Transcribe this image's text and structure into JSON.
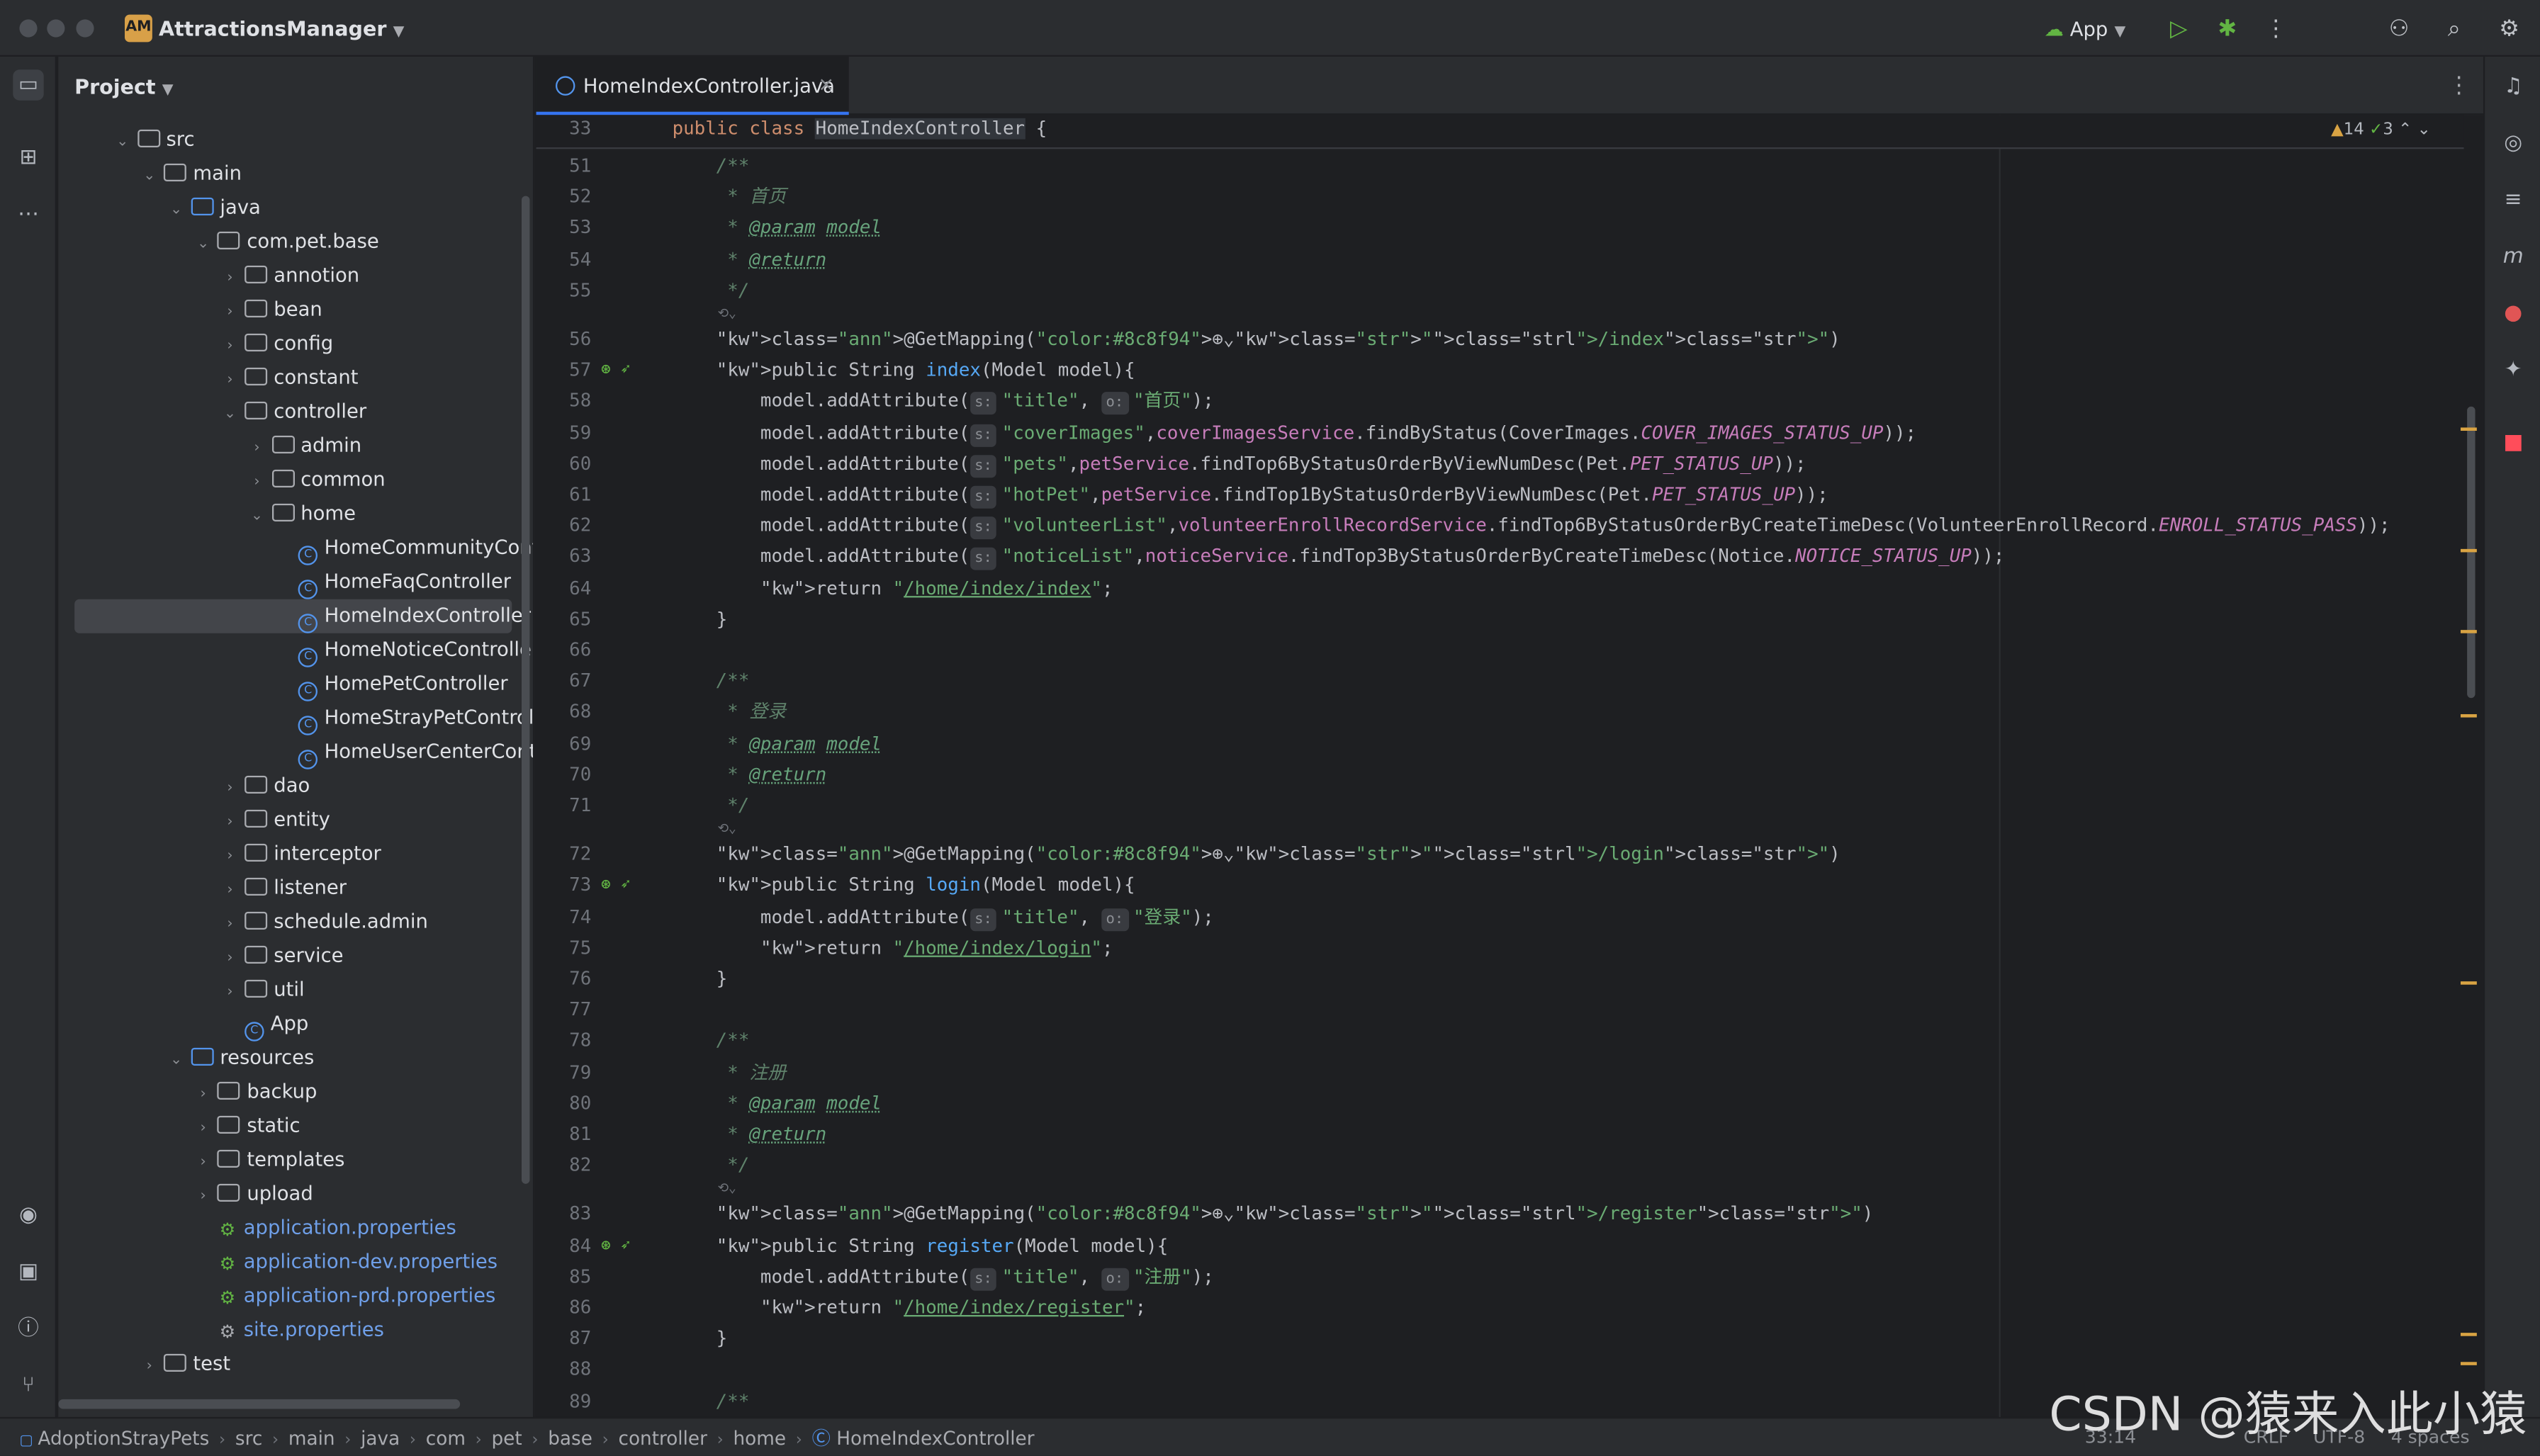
{
  "window": {
    "project_badge": "AM",
    "project_name": "AttractionsManager",
    "run_config": "App"
  },
  "project_panel": {
    "title": "Project",
    "tree": [
      {
        "label": "src",
        "depth": 2,
        "type": "folder",
        "expanded": true
      },
      {
        "label": "main",
        "depth": 3,
        "type": "folder",
        "expanded": true
      },
      {
        "label": "java",
        "depth": 4,
        "type": "folder-src",
        "expanded": true
      },
      {
        "label": "com.pet.base",
        "depth": 5,
        "type": "package",
        "expanded": true
      },
      {
        "label": "annotion",
        "depth": 6,
        "type": "package",
        "expanded": false
      },
      {
        "label": "bean",
        "depth": 6,
        "type": "package",
        "expanded": false
      },
      {
        "label": "config",
        "depth": 6,
        "type": "package",
        "expanded": false
      },
      {
        "label": "constant",
        "depth": 6,
        "type": "package",
        "expanded": false
      },
      {
        "label": "controller",
        "depth": 6,
        "type": "package",
        "expanded": true
      },
      {
        "label": "admin",
        "depth": 7,
        "type": "package",
        "expanded": false
      },
      {
        "label": "common",
        "depth": 7,
        "type": "package",
        "expanded": false
      },
      {
        "label": "home",
        "depth": 7,
        "type": "package",
        "expanded": true
      },
      {
        "label": "HomeCommunityContr",
        "depth": 8,
        "type": "class"
      },
      {
        "label": "HomeFaqController",
        "depth": 8,
        "type": "class"
      },
      {
        "label": "HomeIndexController",
        "depth": 8,
        "type": "class",
        "selected": true
      },
      {
        "label": "HomeNoticeController",
        "depth": 8,
        "type": "class"
      },
      {
        "label": "HomePetController",
        "depth": 8,
        "type": "class"
      },
      {
        "label": "HomeStrayPetControlle",
        "depth": 8,
        "type": "class"
      },
      {
        "label": "HomeUserCenterContr",
        "depth": 8,
        "type": "class"
      },
      {
        "label": "dao",
        "depth": 6,
        "type": "package",
        "expanded": false
      },
      {
        "label": "entity",
        "depth": 6,
        "type": "package",
        "expanded": false
      },
      {
        "label": "interceptor",
        "depth": 6,
        "type": "package",
        "expanded": false
      },
      {
        "label": "listener",
        "depth": 6,
        "type": "package",
        "expanded": false
      },
      {
        "label": "schedule.admin",
        "depth": 6,
        "type": "package",
        "expanded": false
      },
      {
        "label": "service",
        "depth": 6,
        "type": "package",
        "expanded": false
      },
      {
        "label": "util",
        "depth": 6,
        "type": "package",
        "expanded": false
      },
      {
        "label": "App",
        "depth": 6,
        "type": "app"
      },
      {
        "label": "resources",
        "depth": 4,
        "type": "folder-res",
        "expanded": true
      },
      {
        "label": "backup",
        "depth": 5,
        "type": "folder",
        "expanded": false
      },
      {
        "label": "static",
        "depth": 5,
        "type": "folder",
        "expanded": false
      },
      {
        "label": "templates",
        "depth": 5,
        "type": "folder",
        "expanded": false
      },
      {
        "label": "upload",
        "depth": 5,
        "type": "folder",
        "expanded": false
      },
      {
        "label": "application.properties",
        "depth": 5,
        "type": "props"
      },
      {
        "label": "application-dev.properties",
        "depth": 5,
        "type": "props"
      },
      {
        "label": "application-prd.properties",
        "depth": 5,
        "type": "props"
      },
      {
        "label": "site.properties",
        "depth": 5,
        "type": "settings"
      },
      {
        "label": "test",
        "depth": 3,
        "type": "folder",
        "expanded": false
      }
    ]
  },
  "editor": {
    "tab_label": "HomeIndexController.java",
    "inspections": {
      "warnings": "14",
      "ok": "3"
    },
    "sticky_line": {
      "num": "33",
      "text": "public class HomeIndexController {"
    },
    "lines": [
      {
        "n": "51",
        "t": "    /**"
      },
      {
        "n": "52",
        "t": "     * 首页"
      },
      {
        "n": "53",
        "t": "     * @param model"
      },
      {
        "n": "54",
        "t": "     * @return"
      },
      {
        "n": "55",
        "t": "     */"
      },
      {
        "n": "",
        "t": ""
      },
      {
        "n": "56",
        "t": "    @GetMapping(\"/index\")"
      },
      {
        "n": "57",
        "t": "    public String index(Model model){"
      },
      {
        "n": "58",
        "t": "        model.addAttribute( \"title\", \"首页\");"
      },
      {
        "n": "59",
        "t": "        model.addAttribute( \"coverImages\",coverImagesService.findByStatus(CoverImages.COVER_IMAGES_STATUS_UP));"
      },
      {
        "n": "60",
        "t": "        model.addAttribute( \"pets\",petService.findTop6ByStatusOrderByViewNumDesc(Pet.PET_STATUS_UP));"
      },
      {
        "n": "61",
        "t": "        model.addAttribute( \"hotPet\",petService.findTop1ByStatusOrderByViewNumDesc(Pet.PET_STATUS_UP));"
      },
      {
        "n": "62",
        "t": "        model.addAttribute( \"volunteerList\",volunteerEnrollRecordService.findTop6ByStatusOrderByCreateTimeDesc(VolunteerEnrollRecord.ENROLL_STATUS_PASS));"
      },
      {
        "n": "63",
        "t": "        model.addAttribute( \"noticeList\",noticeService.findTop3ByStatusOrderByCreateTimeDesc(Notice.NOTICE_STATUS_UP));"
      },
      {
        "n": "64",
        "t": "        return \"/home/index/index\";"
      },
      {
        "n": "65",
        "t": "    }"
      },
      {
        "n": "66",
        "t": ""
      },
      {
        "n": "67",
        "t": "    /**"
      },
      {
        "n": "68",
        "t": "     * 登录"
      },
      {
        "n": "69",
        "t": "     * @param model"
      },
      {
        "n": "70",
        "t": "     * @return"
      },
      {
        "n": "71",
        "t": "     */"
      },
      {
        "n": "",
        "t": ""
      },
      {
        "n": "72",
        "t": "    @GetMapping(\"/login\")"
      },
      {
        "n": "73",
        "t": "    public String login(Model model){"
      },
      {
        "n": "74",
        "t": "        model.addAttribute( \"title\", \"登录\");"
      },
      {
        "n": "75",
        "t": "        return \"/home/index/login\";"
      },
      {
        "n": "76",
        "t": "    }"
      },
      {
        "n": "77",
        "t": ""
      },
      {
        "n": "78",
        "t": "    /**"
      },
      {
        "n": "79",
        "t": "     * 注册"
      },
      {
        "n": "80",
        "t": "     * @param model"
      },
      {
        "n": "81",
        "t": "     * @return"
      },
      {
        "n": "82",
        "t": "     */"
      },
      {
        "n": "",
        "t": ""
      },
      {
        "n": "83",
        "t": "    @GetMapping(\"/register\")"
      },
      {
        "n": "84",
        "t": "    public String register(Model model){"
      },
      {
        "n": "85",
        "t": "        model.addAttribute( \"title\", \"注册\");"
      },
      {
        "n": "86",
        "t": "        return \"/home/index/register\";"
      },
      {
        "n": "87",
        "t": "    }"
      },
      {
        "n": "88",
        "t": ""
      },
      {
        "n": "89",
        "t": "    /**"
      }
    ]
  },
  "statusbar": {
    "breadcrumbs": [
      "AdoptionStrayPets",
      "src",
      "main",
      "java",
      "com",
      "pet",
      "base",
      "controller",
      "home",
      "HomeIndexController"
    ],
    "position": "33:14",
    "line_sep": "CRLF",
    "encoding": "UTF-8",
    "indent": "4 spaces"
  },
  "watermark": "CSDN @猿来入此小猿",
  "colors": {
    "accent": "#3574f0",
    "keyword": "#cf8e6d",
    "string": "#6aab73",
    "function": "#56a8f5",
    "field": "#c77dbb",
    "annotation": "#b3ae60"
  }
}
